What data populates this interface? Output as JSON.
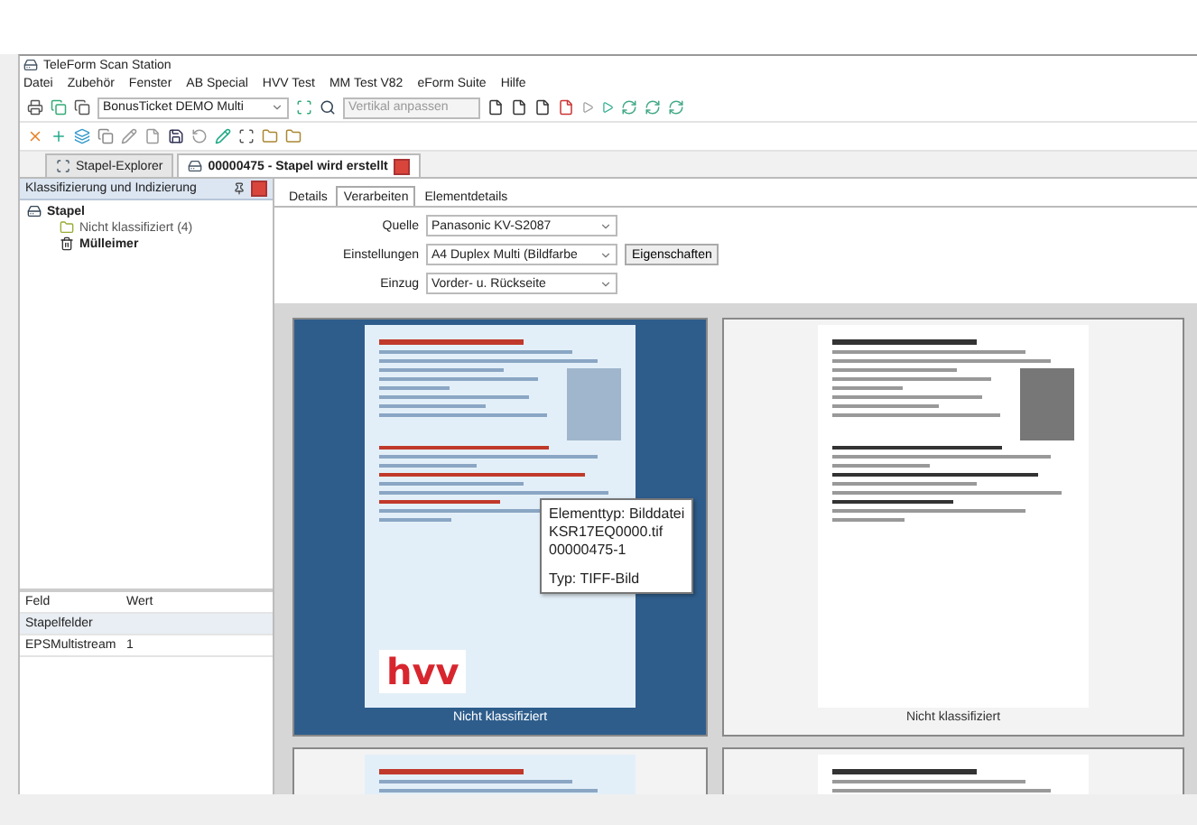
{
  "window": {
    "title": "TeleForm Scan Station"
  },
  "menu": [
    "Datei",
    "Zubehör",
    "Fenster",
    "AB Special",
    "HVV Test",
    "MM Test V82",
    "eForm Suite",
    "Hilfe"
  ],
  "toolbar": {
    "batch_select": "BonusTicket DEMO Multi",
    "zoom_select": "Vertikal anpassen"
  },
  "doc_tabs": [
    {
      "label": "Stapel-Explorer",
      "selected": false
    },
    {
      "label": "00000475 - Stapel wird erstellt",
      "selected": true
    }
  ],
  "left_panel": {
    "title": "Klassifizierung und Indizierung",
    "tree": [
      {
        "label": "Stapel",
        "children": [
          {
            "label": "Nicht klassifiziert (4)",
            "kind": "folder"
          },
          {
            "label": "Mülleimer",
            "kind": "trash"
          }
        ]
      }
    ],
    "properties": {
      "columns": [
        "Feld",
        "Wert"
      ],
      "group": "Stapelfelder",
      "rows": [
        {
          "field": "EPSMultistream",
          "value": "1"
        }
      ]
    }
  },
  "content": {
    "tabs": [
      {
        "label": "Details",
        "selected": false
      },
      {
        "label": "Verarbeiten",
        "selected": true
      },
      {
        "label": "Elementdetails",
        "selected": false
      }
    ],
    "source": {
      "label": "Quelle",
      "value": "Panasonic KV-S2087"
    },
    "settings": {
      "label": "Einstellungen",
      "value": "A4 Duplex Multi (Bildfarbe",
      "button": "Eigenschaften"
    },
    "feed": {
      "label": "Einzug",
      "value": "Vorder- u. Rückseite"
    },
    "thumbnails": [
      {
        "caption": "Nicht klassifiziert",
        "selected": true,
        "kind": "color",
        "logo": "hvv"
      },
      {
        "caption": "Nicht klassifiziert",
        "selected": false,
        "kind": "grayscale"
      },
      {
        "selected": false,
        "kind": "color"
      },
      {
        "selected": false,
        "kind": "grayscale"
      }
    ],
    "tooltip": [
      "Elementtyp: Bilddatei",
      "KSR17EQ0000.tif",
      "00000475-1",
      "Typ: TIFF-Bild"
    ]
  }
}
